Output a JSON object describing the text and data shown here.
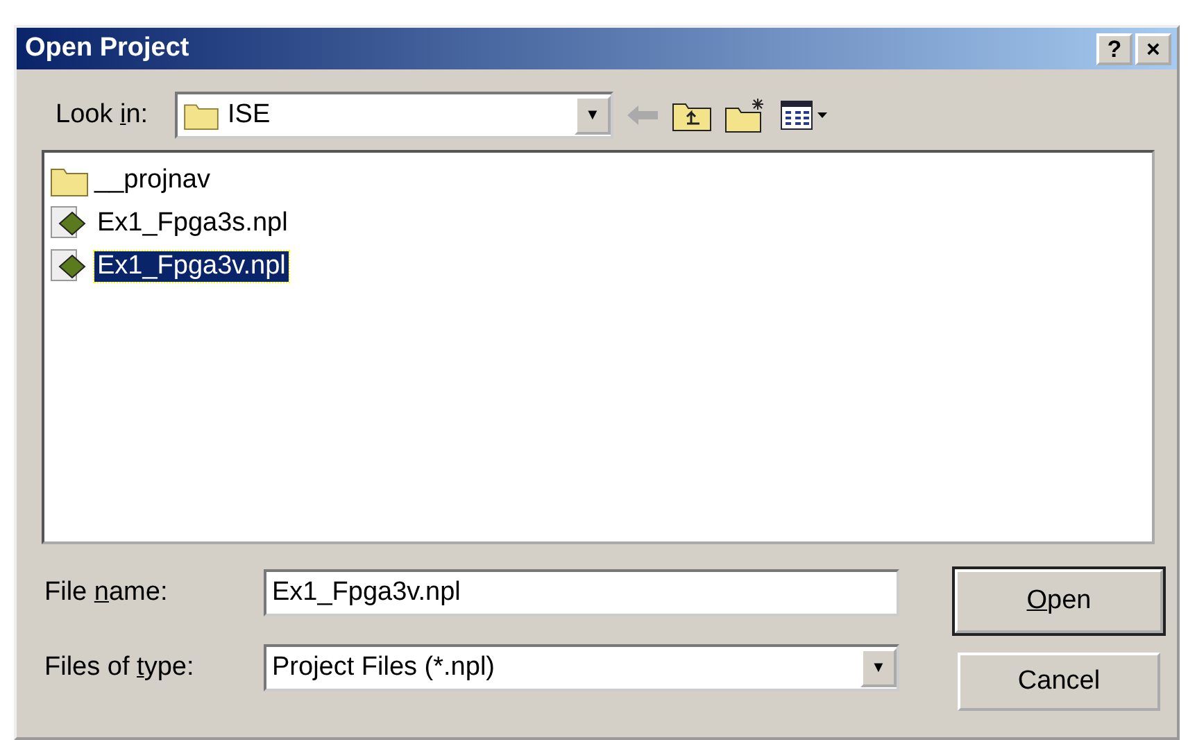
{
  "window": {
    "title": "Open Project",
    "buttons": [
      "?",
      "×"
    ]
  },
  "look_in": {
    "label": {
      "before": "Look ",
      "key": "i",
      "after": "n:"
    },
    "value": "ISE",
    "arrow": "▼"
  },
  "files": [
    {
      "kind": "folder",
      "name": "__projnav",
      "selected": false
    },
    {
      "kind": "project",
      "name": "Ex1_Fpga3s.npl",
      "selected": false
    },
    {
      "kind": "project",
      "name": "Ex1_Fpga3v.npl",
      "selected": true
    }
  ],
  "file_name": {
    "label": {
      "before": "File ",
      "key": "n",
      "after": "ame:"
    },
    "value": "Ex1_Fpga3v.npl"
  },
  "file_type": {
    "label": {
      "before": "Files of ",
      "key": "t",
      "after": "ype:"
    },
    "value": "Project Files (*.npl)",
    "arrow": "▼"
  },
  "buttons": [
    {
      "label": {
        "key": "O",
        "after": "pen"
      },
      "default": true
    },
    {
      "label": {
        "before": "Cancel"
      },
      "default": false
    }
  ]
}
